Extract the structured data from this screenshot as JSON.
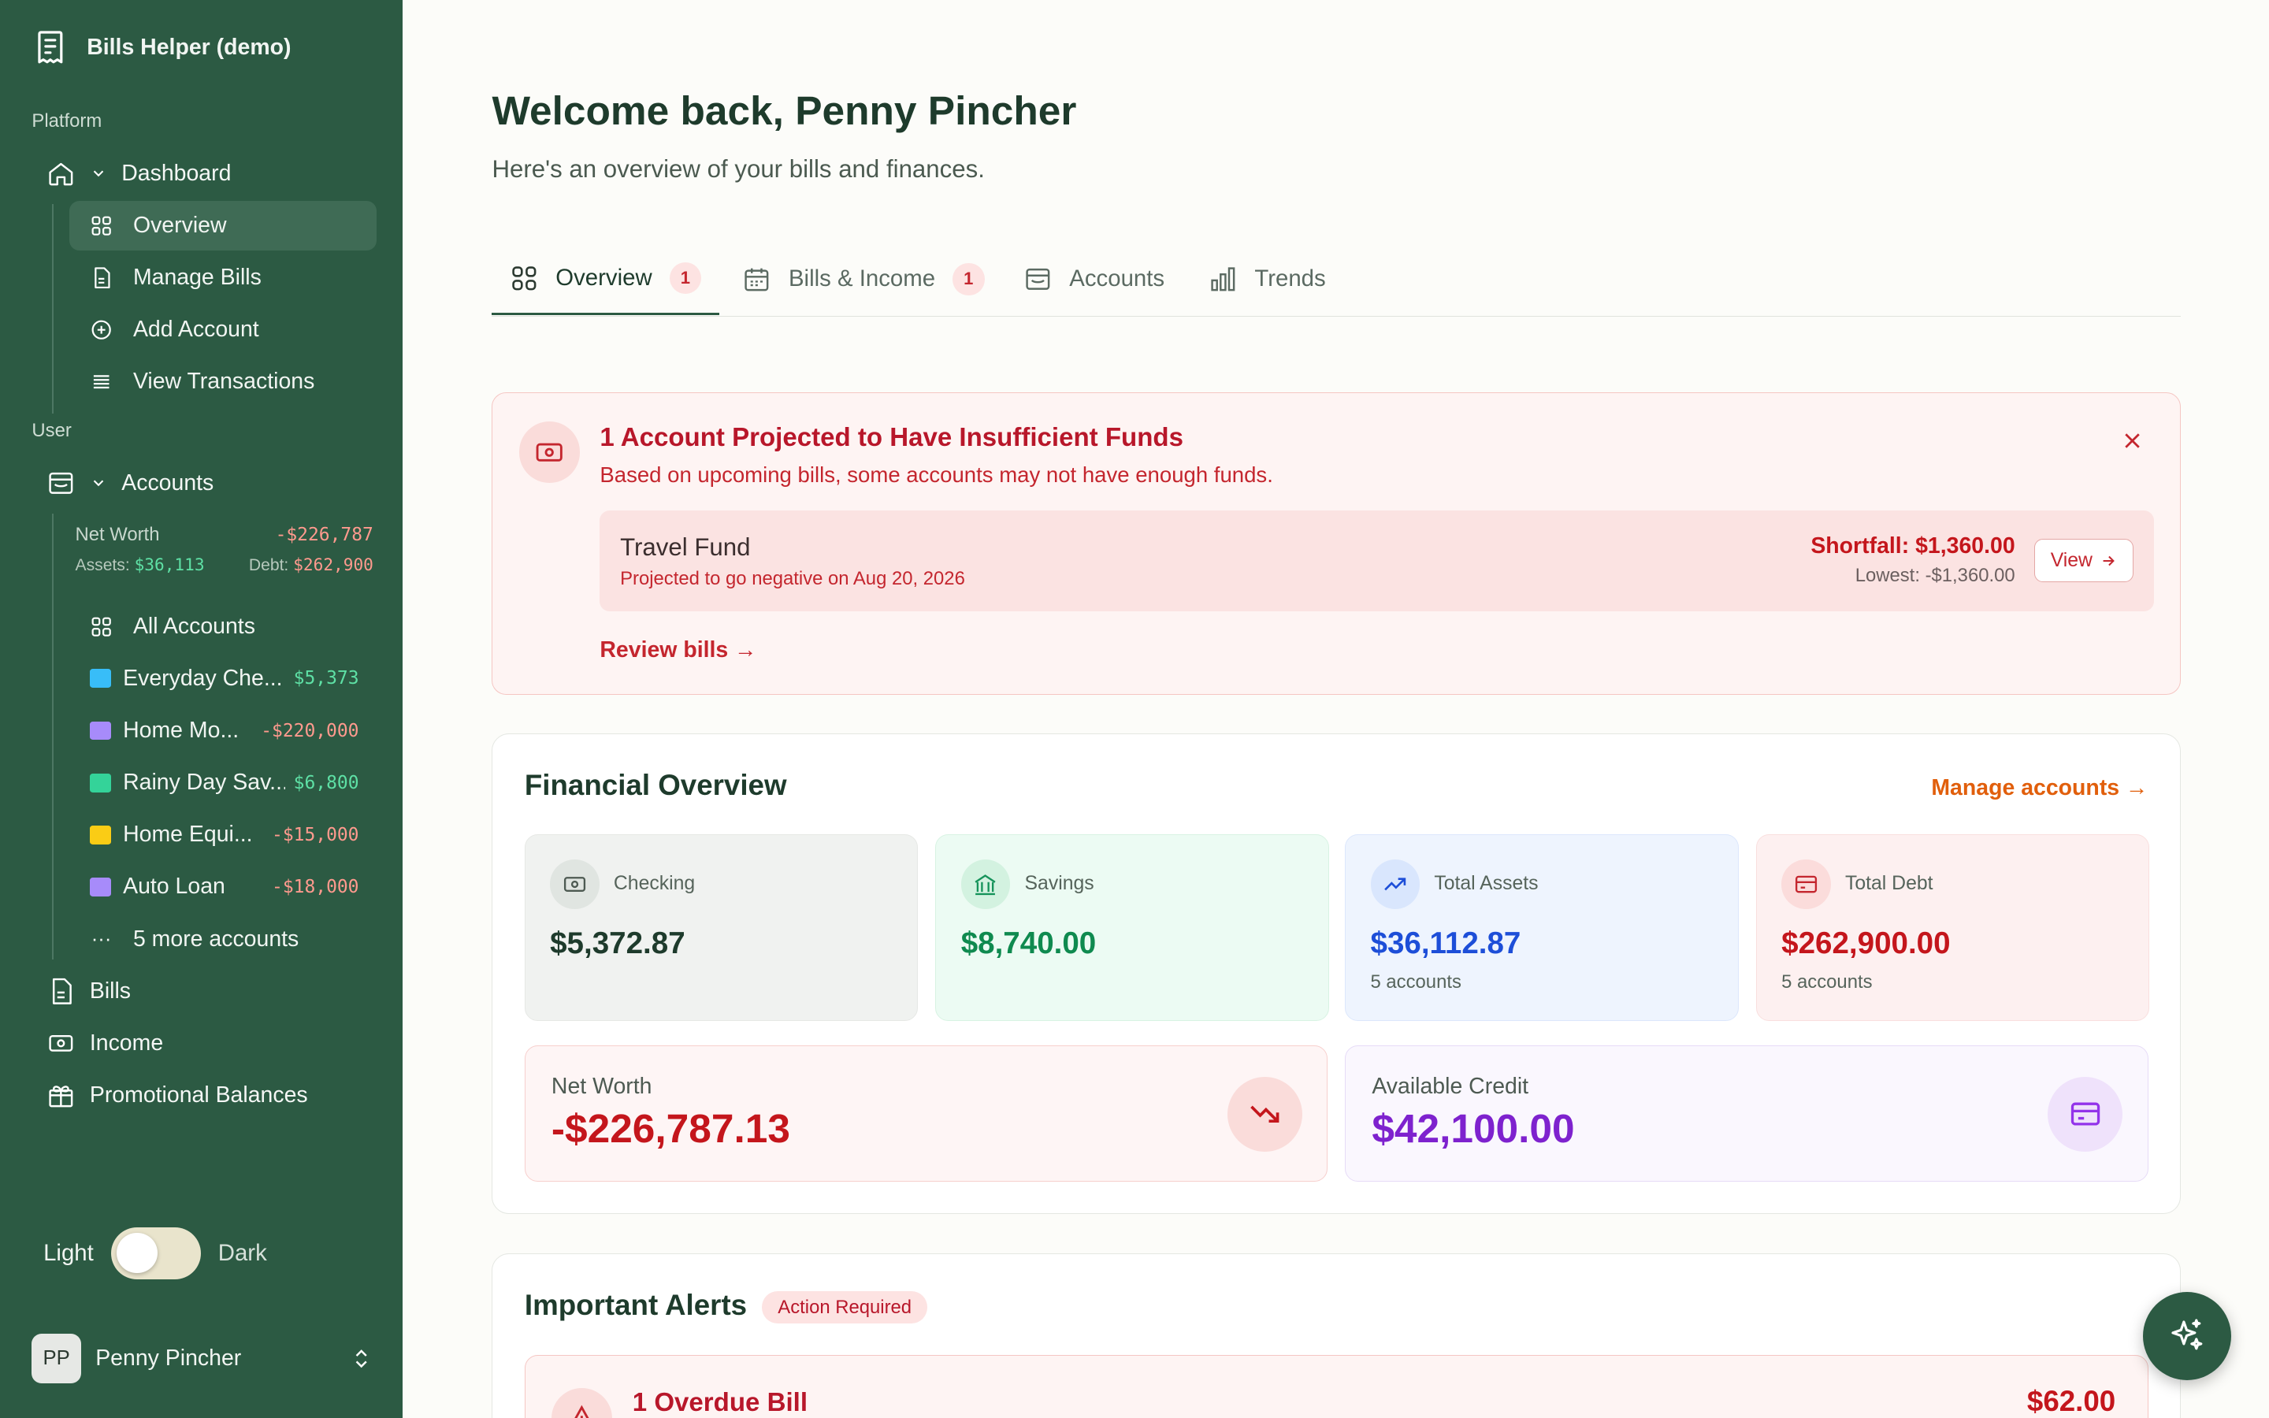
{
  "app": {
    "name": "Bills Helper (demo)"
  },
  "sidebar": {
    "platform_label": "Platform",
    "dashboard_label": "Dashboard",
    "dashboard_items": [
      "Overview",
      "Manage Bills",
      "Add Account",
      "View Transactions"
    ],
    "user_label": "User",
    "accounts_label": "Accounts",
    "net_worth": {
      "label": "Net Worth",
      "value": "-$226,787",
      "assets_label": "Assets:",
      "assets": "$36,113",
      "debt_label": "Debt:",
      "debt": "$262,900"
    },
    "all_accounts_label": "All Accounts",
    "accounts": [
      {
        "name": "Everyday Che...",
        "amount": "$5,373",
        "color": "#38bdf8",
        "type": "positive"
      },
      {
        "name": "Home Mo...",
        "amount": "-$220,000",
        "color": "#a78bfa",
        "type": "negative"
      },
      {
        "name": "Rainy Day Sav...",
        "amount": "$6,800",
        "color": "#34d399",
        "type": "positive"
      },
      {
        "name": "Home Equi...",
        "amount": "-$15,000",
        "color": "#facc15",
        "type": "negative"
      },
      {
        "name": "Auto Loan",
        "amount": "-$18,000",
        "color": "#a78bfa",
        "type": "negative"
      }
    ],
    "more_accounts": "5 more accounts",
    "bottom_items": [
      "Bills",
      "Income",
      "Promotional Balances"
    ],
    "theme": {
      "light": "Light",
      "dark": "Dark"
    },
    "user": {
      "initials": "PP",
      "name": "Penny Pincher"
    }
  },
  "main": {
    "welcome": "Welcome back, Penny Pincher",
    "subtitle": "Here's an overview of your bills and finances.",
    "tabs": [
      {
        "label": "Overview",
        "badge": "1"
      },
      {
        "label": "Bills & Income",
        "badge": "1"
      },
      {
        "label": "Accounts",
        "badge": ""
      },
      {
        "label": "Trends",
        "badge": ""
      }
    ],
    "insufficient": {
      "title": "1 Account Projected to Have Insufficient Funds",
      "description": "Based on upcoming bills, some accounts may not have enough funds.",
      "account_name": "Travel Fund",
      "projection": "Projected to go negative on Aug 20, 2026",
      "shortfall": "Shortfall: $1,360.00",
      "lowest": "Lowest: -$1,360.00",
      "view_label": "View",
      "review_label": "Review bills →"
    },
    "financial": {
      "title": "Financial Overview",
      "manage_label": "Manage accounts →",
      "stats": [
        {
          "label": "Checking",
          "value": "$5,372.87",
          "sub": ""
        },
        {
          "label": "Savings",
          "value": "$8,740.00",
          "sub": ""
        },
        {
          "label": "Total Assets",
          "value": "$36,112.87",
          "sub": "5 accounts"
        },
        {
          "label": "Total Debt",
          "value": "$262,900.00",
          "sub": "5 accounts"
        }
      ],
      "net_worth_label": "Net Worth",
      "net_worth_value": "-$226,787.13",
      "credit_label": "Available Credit",
      "credit_value": "$42,100.00"
    },
    "alerts": {
      "title": "Important Alerts",
      "badge": "Action Required",
      "overdue_title": "1 Overdue Bill",
      "overdue_amount": "$62.00"
    }
  },
  "colors": {
    "sidebar": "#2c5a43",
    "danger": "#c4262e",
    "accent": "#e15f0c",
    "assets": "#1d4ed8",
    "credit": "#7e22ce"
  }
}
